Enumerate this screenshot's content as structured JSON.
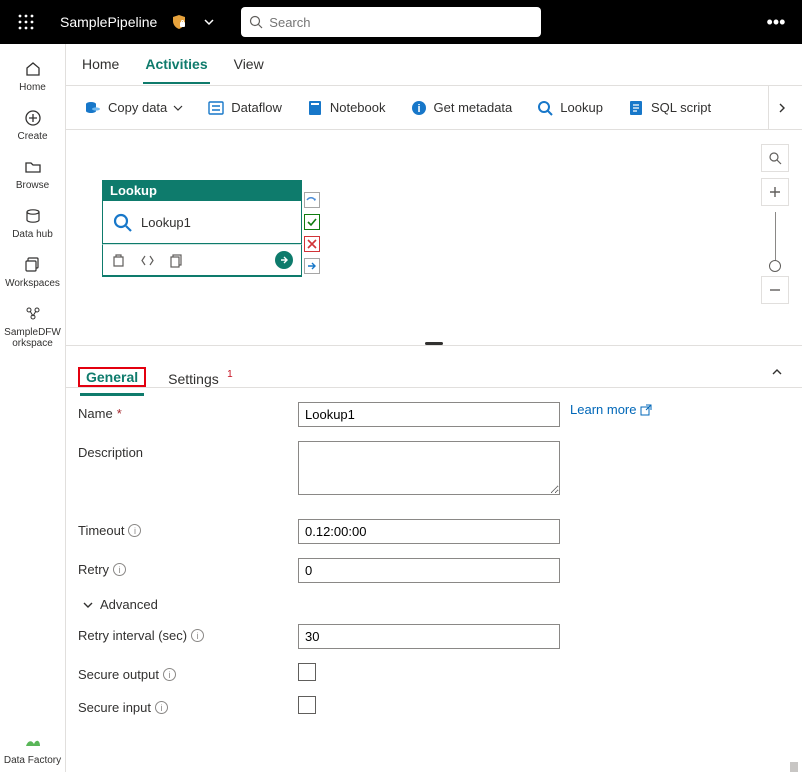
{
  "topbar": {
    "title": "SamplePipeline",
    "search_placeholder": "Search",
    "more_label": "•••"
  },
  "leftnav": {
    "items": [
      {
        "label": "Home"
      },
      {
        "label": "Create"
      },
      {
        "label": "Browse"
      },
      {
        "label": "Data hub"
      },
      {
        "label": "Workspaces"
      },
      {
        "label": "SampleDFWorkspace"
      }
    ],
    "footer": {
      "label": "Data Factory"
    }
  },
  "tabs": {
    "items": [
      {
        "label": "Home"
      },
      {
        "label": "Activities"
      },
      {
        "label": "View"
      }
    ],
    "active_index": 1
  },
  "toolbar": {
    "items": [
      {
        "label": "Copy data",
        "icon": "copy-data-icon",
        "color": "#1777c9",
        "dropdown": true
      },
      {
        "label": "Dataflow",
        "icon": "dataflow-icon",
        "color": "#1777c9"
      },
      {
        "label": "Notebook",
        "icon": "notebook-icon",
        "color": "#1777c9"
      },
      {
        "label": "Get metadata",
        "icon": "info-icon",
        "color": "#1777c9"
      },
      {
        "label": "Lookup",
        "icon": "lookup-icon",
        "color": "#1777c9"
      },
      {
        "label": "SQL script",
        "icon": "sql-icon",
        "color": "#1777c9"
      }
    ]
  },
  "canvas": {
    "node": {
      "type_label": "Lookup",
      "name": "Lookup1"
    }
  },
  "panel": {
    "tabs": [
      {
        "label": "General"
      },
      {
        "label": "Settings",
        "badge": "1"
      }
    ],
    "active_index": 0,
    "learn_more": "Learn more",
    "advanced_label": "Advanced",
    "fields": {
      "name": {
        "label": "Name",
        "value": "Lookup1",
        "required": true
      },
      "description": {
        "label": "Description",
        "value": ""
      },
      "timeout": {
        "label": "Timeout",
        "value": "0.12:00:00"
      },
      "retry": {
        "label": "Retry",
        "value": "0"
      },
      "retry_interval": {
        "label": "Retry interval (sec)",
        "value": "30"
      },
      "secure_output": {
        "label": "Secure output",
        "value": false
      },
      "secure_input": {
        "label": "Secure input",
        "value": false
      }
    }
  }
}
